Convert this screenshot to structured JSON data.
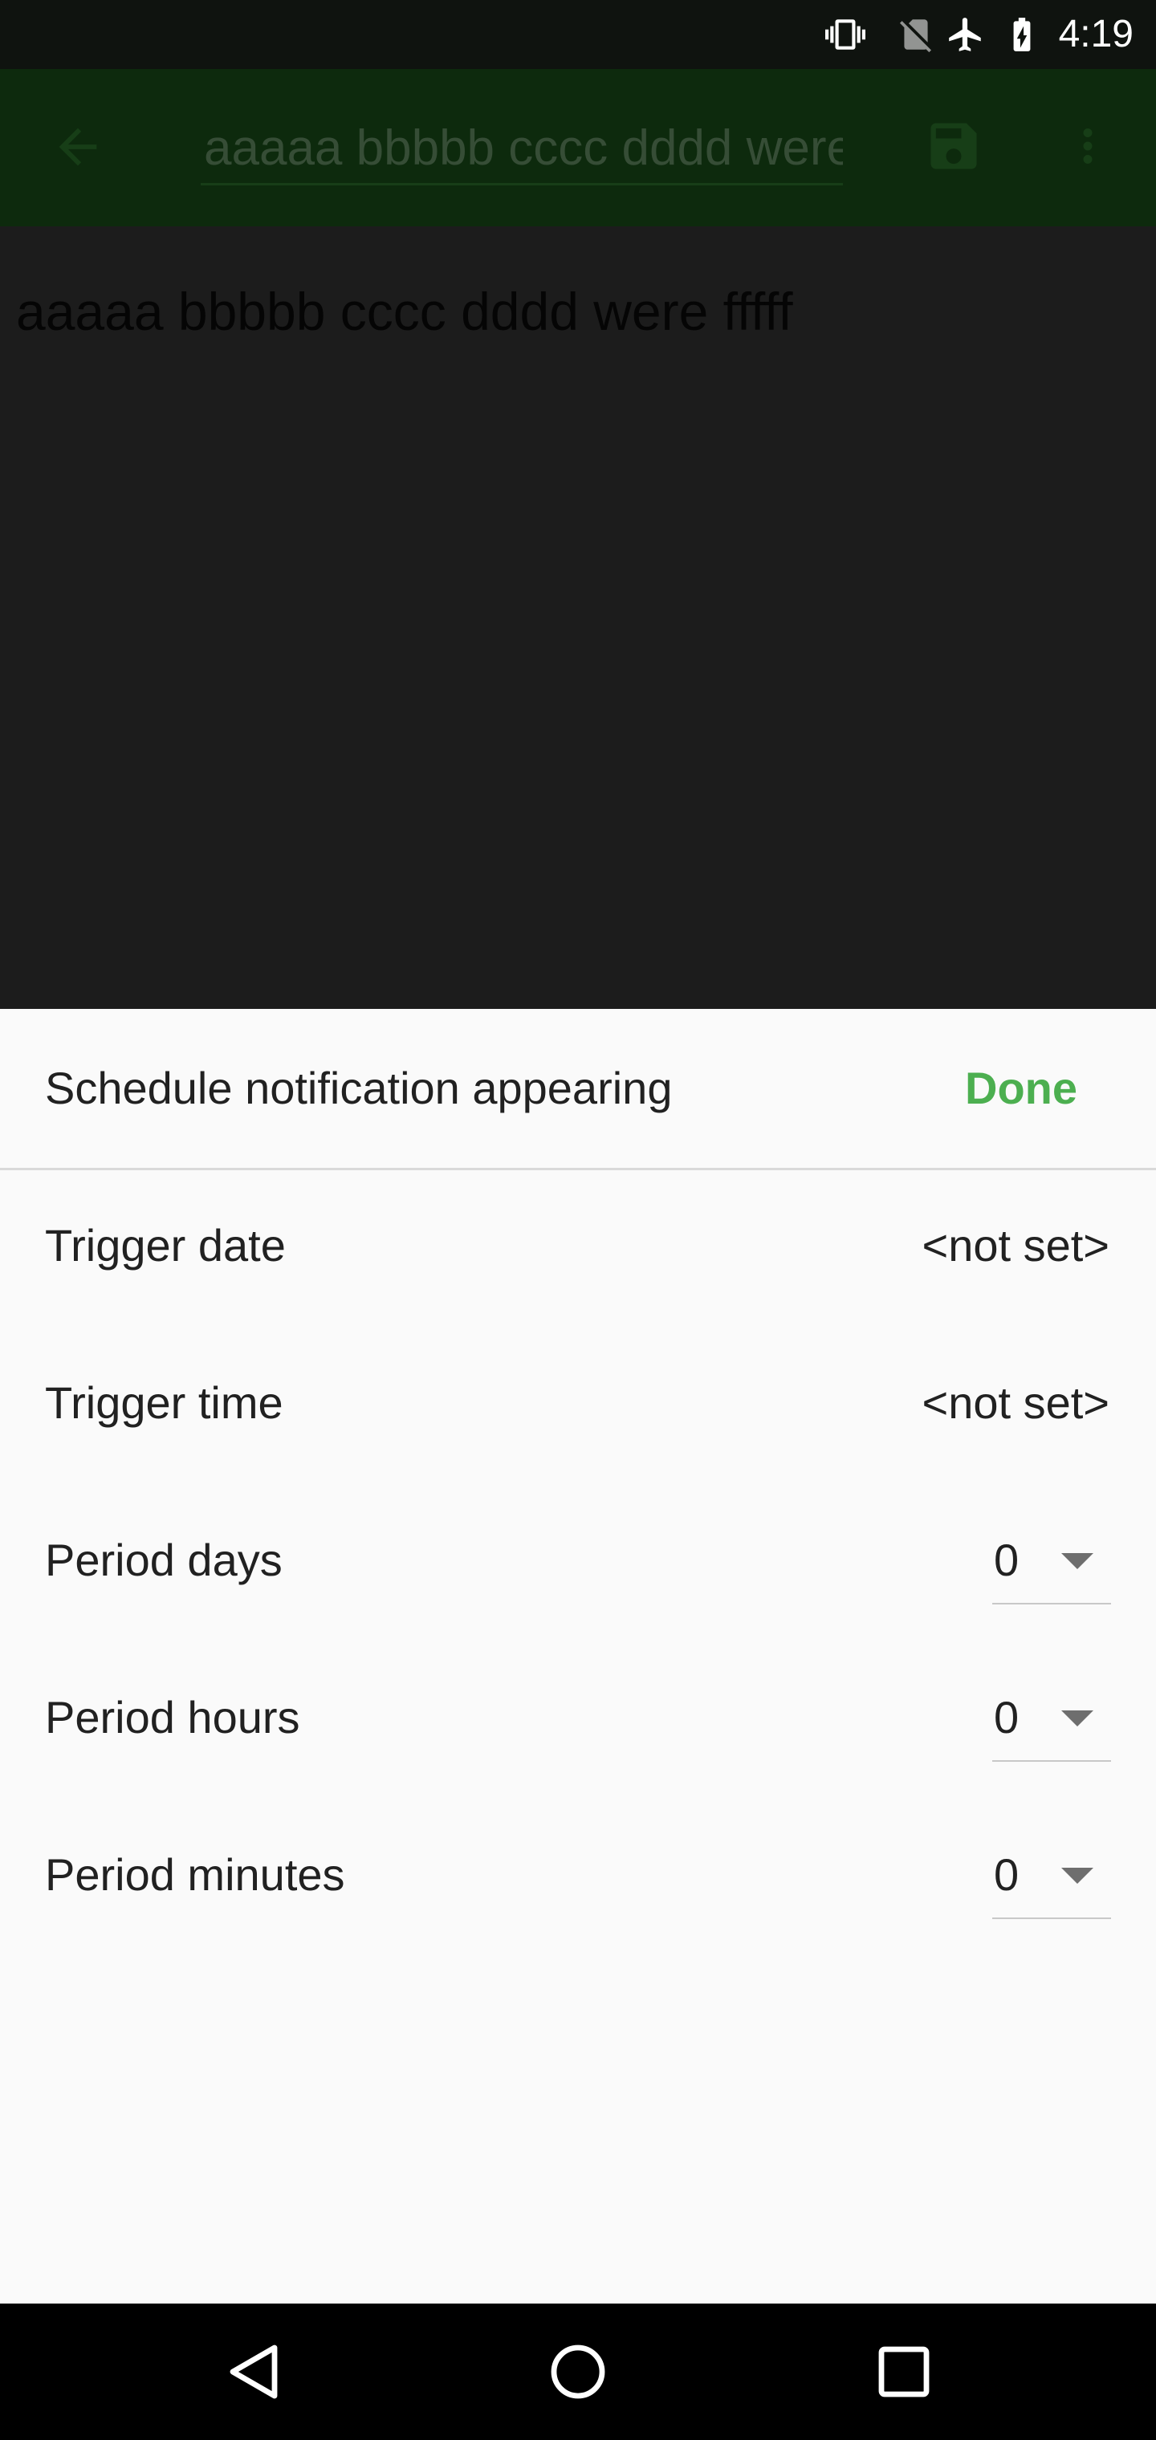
{
  "status_bar": {
    "time": "4:19",
    "icons": [
      "vibrate-icon",
      "no-sim-icon",
      "airplane-mode-icon",
      "battery-charging-icon"
    ]
  },
  "app_bar": {
    "title_value": "aaaaa bbbbb cccc dddd were fffff",
    "icons": [
      "back-arrow-icon",
      "save-icon",
      "more-vert-icon"
    ]
  },
  "note": {
    "body_text": "aaaaa bbbbb cccc dddd were fffff"
  },
  "sheet": {
    "title": "Schedule notification appearing",
    "done_label": "Done",
    "rows": [
      {
        "label": "Trigger date",
        "value": "<not set>"
      },
      {
        "label": "Trigger time",
        "value": "<not set>"
      },
      {
        "label": "Period days",
        "value": "0"
      },
      {
        "label": "Period hours",
        "value": "0"
      },
      {
        "label": "Period minutes",
        "value": "0"
      }
    ]
  },
  "colors": {
    "accent": "#4caf50",
    "app_bar_dimmed": "#0d2a0d",
    "scrim_background": "#1c1c1c",
    "sheet_background": "#fafafa"
  },
  "nav_bar": {
    "icons": [
      "nav-back-icon",
      "nav-home-icon",
      "nav-recents-icon"
    ]
  }
}
